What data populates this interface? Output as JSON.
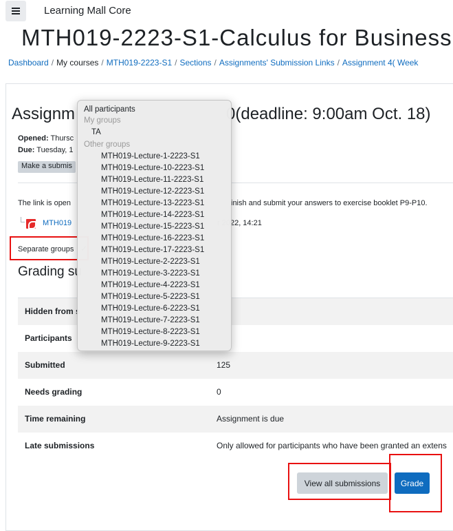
{
  "navbar": {
    "site_name": "Learning Mall Core"
  },
  "course_title": "MTH019-2223-S1-Calculus for Business",
  "breadcrumb": {
    "dashboard": "Dashboard",
    "my_courses": "My courses",
    "course": "MTH019-2223-S1",
    "sections": "Sections",
    "links": "Assignments' Submission Links",
    "current": "Assignment 4( Week"
  },
  "assignment": {
    "heading_left": "Assignm",
    "heading_right": "0(deadline: 9:00am Oct. 18)",
    "opened_label": "Opened:",
    "opened_value": " Thursc",
    "due_label": "Due:",
    "due_value": " Tuesday, 1",
    "make_submission": "Make a submis",
    "intro_left": "The link is open",
    "intro_right": "inish and submit your answers to exercise booklet P9-P10.",
    "file_name": "MTH019",
    "file_date": "r 2022, 14:21"
  },
  "group_selector": {
    "label": "Separate groups",
    "checkmark": "✓"
  },
  "grading_summary": {
    "title": "Grading su",
    "rows": [
      {
        "label": "Hidden from s",
        "value": ""
      },
      {
        "label": "Participants",
        "value": ""
      },
      {
        "label": "Submitted",
        "value": "125"
      },
      {
        "label": "Needs grading",
        "value": "0"
      },
      {
        "label": "Time remaining",
        "value": "Assignment is due"
      },
      {
        "label": "Late submissions",
        "value": "Only allowed for participants who have been granted an extens"
      }
    ]
  },
  "buttons": {
    "view_all": "View all submissions",
    "grade": "Grade"
  },
  "dropdown": {
    "all_participants": "All participants",
    "my_groups_header": "My groups",
    "my_groups": [
      "TA"
    ],
    "other_groups_header": "Other groups",
    "other_groups": [
      "MTH019-Lecture-1-2223-S1",
      "MTH019-Lecture-10-2223-S1",
      "MTH019-Lecture-11-2223-S1",
      "MTH019-Lecture-12-2223-S1",
      "MTH019-Lecture-13-2223-S1",
      "MTH019-Lecture-14-2223-S1",
      "MTH019-Lecture-15-2223-S1",
      "MTH019-Lecture-16-2223-S1",
      "MTH019-Lecture-17-2223-S1",
      "MTH019-Lecture-2-2223-S1",
      "MTH019-Lecture-3-2223-S1",
      "MTH019-Lecture-4-2223-S1",
      "MTH019-Lecture-5-2223-S1",
      "MTH019-Lecture-6-2223-S1",
      "MTH019-Lecture-7-2223-S1",
      "MTH019-Lecture-8-2223-S1",
      "MTH019-Lecture-9-2223-S1"
    ]
  },
  "colors": {
    "link": "#0f6cbf",
    "primary_button": "#0f6cbf",
    "highlight_box": "#e81010",
    "secondary_button": "#ced4da"
  }
}
